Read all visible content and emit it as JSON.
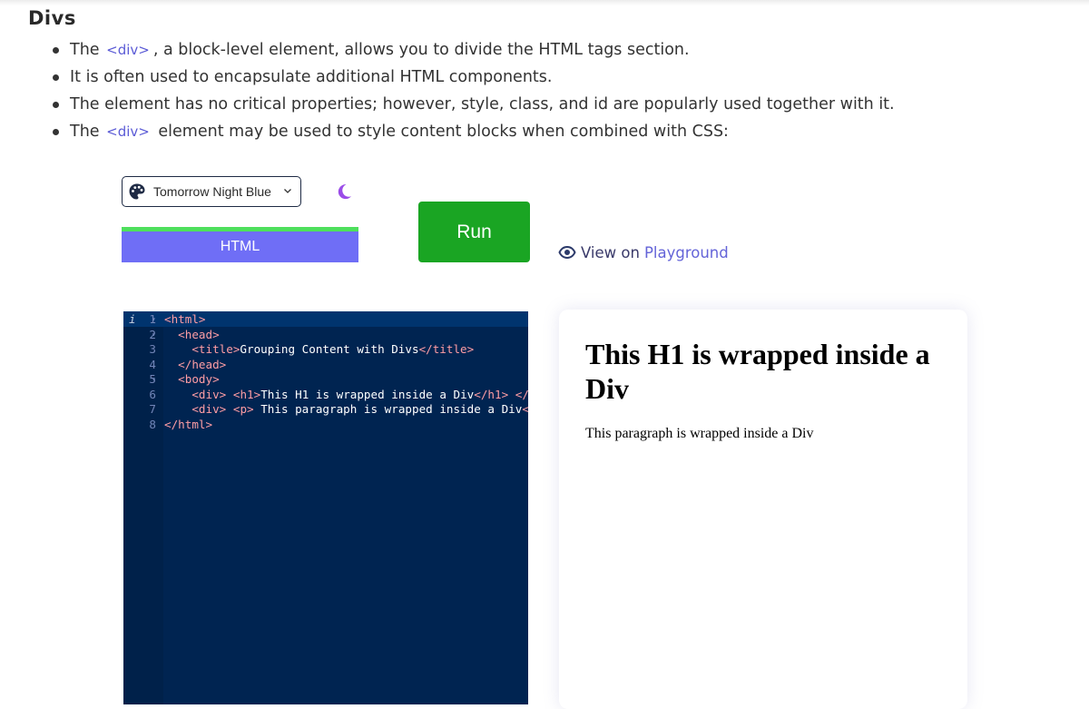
{
  "section": {
    "title": "Divs",
    "bullets": [
      {
        "before": "The ",
        "tag": "<div>",
        "after": ", a block-level element, allows you to divide the HTML  tags section."
      },
      {
        "text": "It is often used to encapsulate additional HTML components."
      },
      {
        "text": "The element has no critical properties; however, style, class, and id are popularly used together with it."
      },
      {
        "before": "The ",
        "tag": "<div>",
        "after": " element may be used to style content blocks when combined with CSS:"
      }
    ]
  },
  "toolbar": {
    "theme_selected": "Tomorrow Night Blue",
    "tab_label": "HTML",
    "run_label": "Run",
    "view_on": "View on",
    "playground": "Playground"
  },
  "editor": {
    "lines": [
      {
        "n": "1",
        "indent": "",
        "parts": [
          {
            "t": "<html>",
            "c": "t"
          }
        ],
        "fold": true,
        "info": true
      },
      {
        "n": "2",
        "indent": "  ",
        "parts": [
          {
            "t": "<head>",
            "c": "t"
          }
        ],
        "fold": true
      },
      {
        "n": "3",
        "indent": "    ",
        "parts": [
          {
            "t": "<title>",
            "c": "t"
          },
          {
            "t": "Grouping Content with Divs",
            "c": ""
          },
          {
            "t": "</title>",
            "c": "t"
          }
        ]
      },
      {
        "n": "4",
        "indent": "  ",
        "parts": [
          {
            "t": "</head>",
            "c": "t"
          }
        ]
      },
      {
        "n": "5",
        "indent": "  ",
        "parts": [
          {
            "t": "<body>",
            "c": "t"
          }
        ],
        "fold": true
      },
      {
        "n": "6",
        "indent": "    ",
        "parts": [
          {
            "t": "<div>",
            "c": "t"
          },
          {
            "t": " ",
            "c": ""
          },
          {
            "t": "<h1>",
            "c": "t"
          },
          {
            "t": "This H1 is wrapped inside a Div",
            "c": ""
          },
          {
            "t": "</h1>",
            "c": "t"
          },
          {
            "t": " ",
            "c": ""
          },
          {
            "t": "</d",
            "c": "t"
          }
        ]
      },
      {
        "n": "7",
        "indent": "    ",
        "parts": [
          {
            "t": "<div>",
            "c": "t"
          },
          {
            "t": " ",
            "c": ""
          },
          {
            "t": "<p>",
            "c": "t"
          },
          {
            "t": " This paragraph is wrapped inside a Div",
            "c": ""
          },
          {
            "t": "</",
            "c": "t"
          }
        ]
      },
      {
        "n": "8",
        "indent": "",
        "parts": [
          {
            "t": "</html>",
            "c": "t"
          }
        ]
      }
    ]
  },
  "preview": {
    "h1": "This H1 is wrapped inside a Div",
    "p": "This paragraph is wrapped inside a Div"
  },
  "colors": {
    "editor_bg": "#002451",
    "tag_color": "#ff9da4",
    "run_green": "#1aa523",
    "tab_purple": "#6f6ef6",
    "tab_accent": "#4ee05c",
    "link_purple": "#6464d8"
  }
}
